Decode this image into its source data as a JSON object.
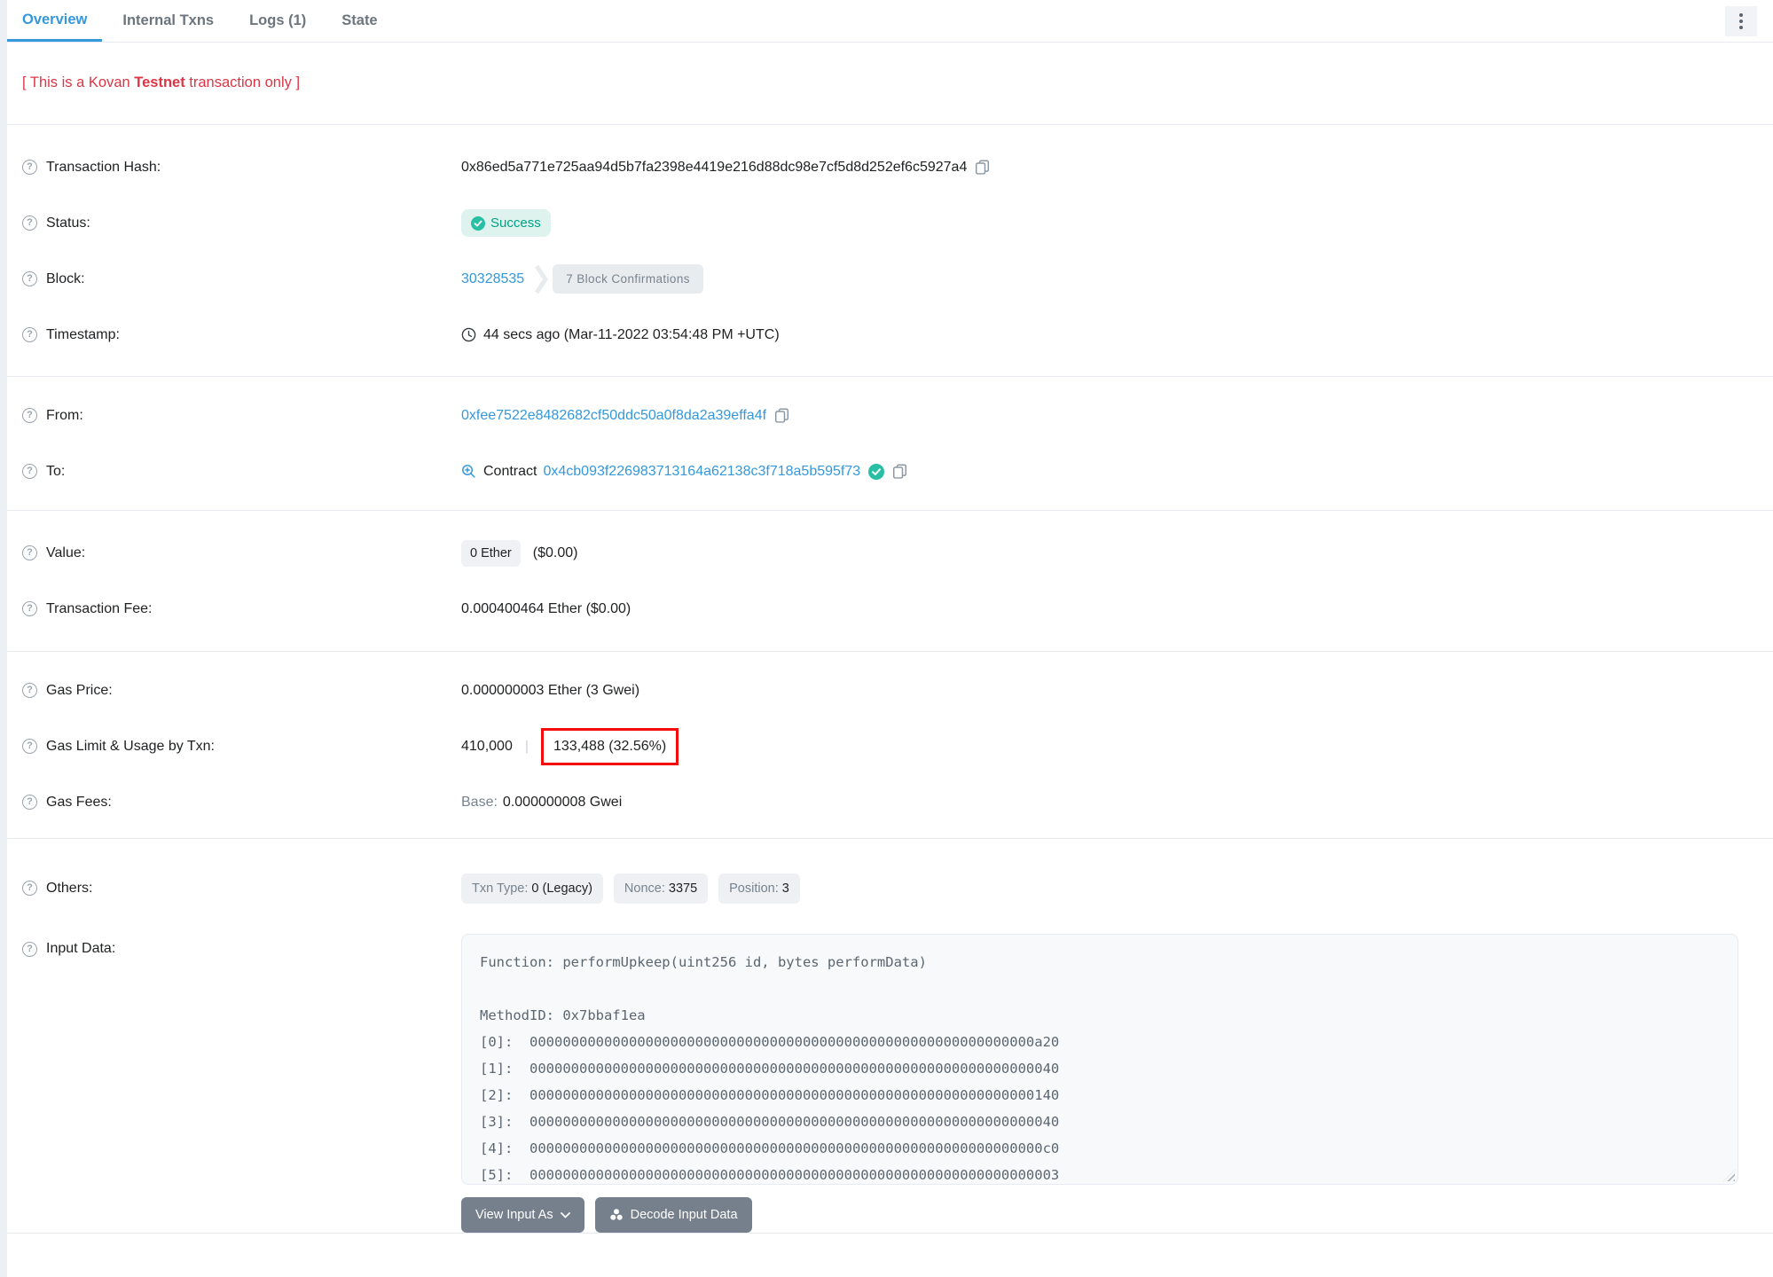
{
  "colors": {
    "accent_blue": "#3498db",
    "success_text": "#00a186",
    "success_bg": "#def3ee",
    "notice_red": "#dc3545",
    "highlight_box_red": "#f40b0b",
    "muted_gray": "#77838f",
    "divider": "#e7eaf3",
    "button_gray": "#75808c"
  },
  "tabs": {
    "items": [
      {
        "label": "Overview",
        "active": true
      },
      {
        "label": "Internal Txns",
        "active": false
      },
      {
        "label": "Logs (1)",
        "active": false
      },
      {
        "label": "State",
        "active": false
      }
    ]
  },
  "notice": {
    "pre": "[ This is a Kovan ",
    "bold": "Testnet",
    "post": " transaction only ]"
  },
  "fields": {
    "transaction_hash": {
      "label": "Transaction Hash:",
      "value": "0x86ed5a771e725aa94d5b7fa2398e4419e216d88dc98e7cf5d8d252ef6c5927a4"
    },
    "status": {
      "label": "Status:",
      "value": "Success"
    },
    "block": {
      "label": "Block:",
      "number": "30328535",
      "confirmations": "7 Block Confirmations"
    },
    "timestamp": {
      "label": "Timestamp:",
      "value": "44 secs ago (Mar-11-2022 03:54:48 PM +UTC)"
    },
    "from": {
      "label": "From:",
      "address": "0xfee7522e8482682cf50ddc50a0f8da2a39effa4f"
    },
    "to": {
      "label": "To:",
      "type": "Contract",
      "address": "0x4cb093f226983713164a62138c3f718a5b595f73"
    },
    "value": {
      "label": "Value:",
      "badge": "0 Ether",
      "usd": "($0.00)"
    },
    "transaction_fee": {
      "label": "Transaction Fee:",
      "value": "0.000400464 Ether ($0.00)"
    },
    "gas_price": {
      "label": "Gas Price:",
      "value": "0.000000003 Ether (3 Gwei)"
    },
    "gas_limit_usage": {
      "label": "Gas Limit & Usage by Txn:",
      "limit": "410,000",
      "separator": "|",
      "usage": "133,488 (32.56%)"
    },
    "gas_fees": {
      "label": "Gas Fees:",
      "base_label": "Base:",
      "base_value": "0.000000008 Gwei"
    },
    "others": {
      "label": "Others:",
      "badges": [
        {
          "name": "Txn Type:",
          "value": "0 (Legacy)"
        },
        {
          "name": "Nonce:",
          "value": "3375"
        },
        {
          "name": "Position:",
          "value": "3"
        }
      ]
    },
    "input_data": {
      "label": "Input Data:",
      "function_line": "Function: performUpkeep(uint256 id, bytes performData)",
      "method_id_line": "MethodID: 0x7bbaf1ea",
      "words": [
        {
          "index": "[0]:",
          "value": "0000000000000000000000000000000000000000000000000000000000000a20"
        },
        {
          "index": "[1]:",
          "value": "0000000000000000000000000000000000000000000000000000000000000040"
        },
        {
          "index": "[2]:",
          "value": "0000000000000000000000000000000000000000000000000000000000000140"
        },
        {
          "index": "[3]:",
          "value": "0000000000000000000000000000000000000000000000000000000000000040"
        },
        {
          "index": "[4]:",
          "value": "00000000000000000000000000000000000000000000000000000000000000c0"
        },
        {
          "index": "[5]:",
          "value": "0000000000000000000000000000000000000000000000000000000000000003"
        }
      ]
    }
  },
  "actions": {
    "view_input_as": "View Input As",
    "decode_input_data": "Decode Input Data"
  }
}
